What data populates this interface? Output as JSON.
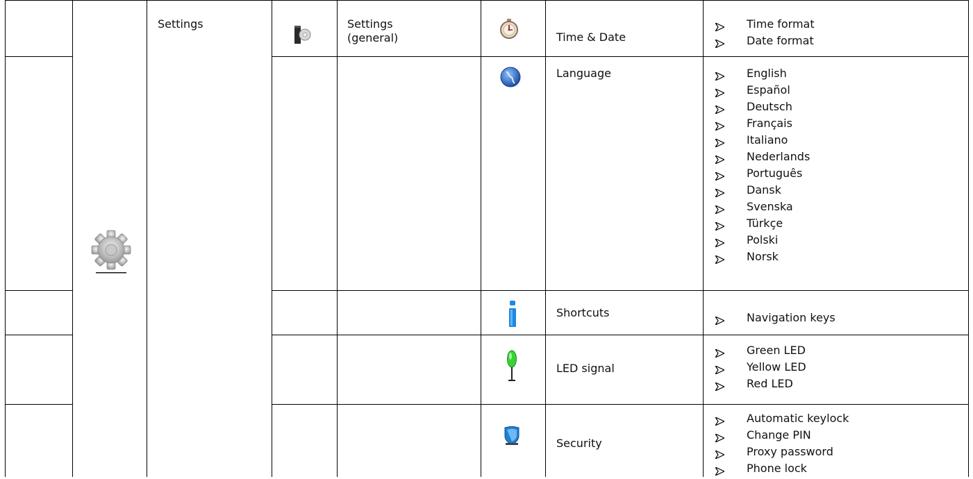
{
  "menu": {
    "title": "Settings",
    "submenu_title": "Settings (general)",
    "icons": {
      "main": "gear-icon",
      "submenu": "settings-general-icon"
    }
  },
  "rows": [
    {
      "icon": "clock-icon",
      "name": "Time & Date",
      "options": [
        "Time format",
        "Date format"
      ]
    },
    {
      "icon": "globe-icon",
      "name": "Language",
      "options": [
        "English",
        "Español",
        "Deutsch",
        "Français",
        "Italiano",
        "Nederlands",
        "Português",
        "Dansk",
        "Svenska",
        "Türkçe",
        "Polski",
        "Norsk"
      ]
    },
    {
      "icon": "info-icon",
      "name": "Shortcuts",
      "options": [
        "Navigation keys"
      ]
    },
    {
      "icon": "green-led-icon",
      "name": "LED signal",
      "options": [
        "Green LED",
        "Yellow LED",
        "Red LED"
      ]
    },
    {
      "icon": "shield-icon",
      "name": "Security",
      "options": [
        "Automatic keylock",
        "Change PIN",
        "Proxy password",
        "Phone lock"
      ]
    }
  ]
}
